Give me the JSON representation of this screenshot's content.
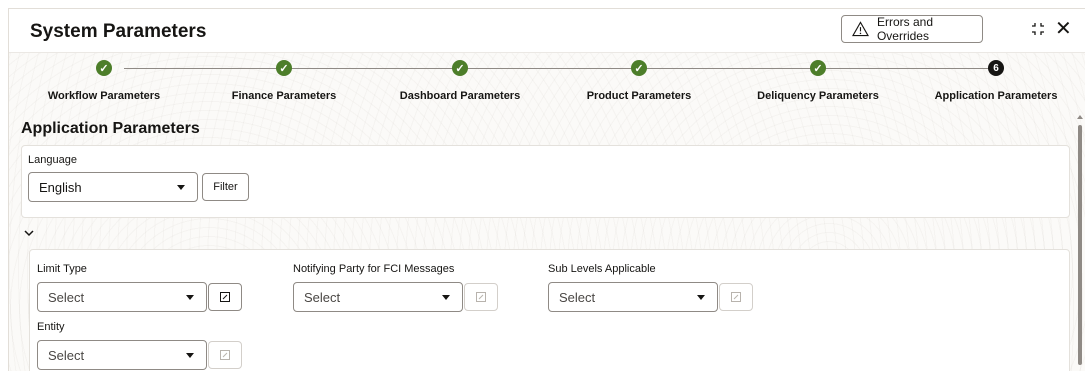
{
  "header": {
    "title": "System Parameters",
    "errors_button": "Errors and Overrides",
    "warning_icon": "warning-triangle-icon",
    "compress_icon": "compress-icon",
    "close_icon": "close-icon",
    "close_glyph": "✕"
  },
  "train": {
    "steps": [
      {
        "label": "Workflow Parameters",
        "status": "done",
        "marker": "✓"
      },
      {
        "label": "Finance Parameters",
        "status": "done",
        "marker": "✓"
      },
      {
        "label": "Dashboard Parameters",
        "status": "done",
        "marker": "✓"
      },
      {
        "label": "Product Parameters",
        "status": "done",
        "marker": "✓"
      },
      {
        "label": "Deliquency Parameters",
        "status": "done",
        "marker": "✓"
      },
      {
        "label": "Application Parameters",
        "status": "current",
        "marker": "6"
      }
    ]
  },
  "section": {
    "title": "Application Parameters"
  },
  "language": {
    "label": "Language",
    "value": "English",
    "filter_button": "Filter"
  },
  "details": {
    "limit_type": {
      "label": "Limit Type",
      "value": "Select"
    },
    "notifying_party": {
      "label": "Notifying Party for FCI Messages",
      "value": "Select"
    },
    "sub_levels": {
      "label": "Sub Levels Applicable",
      "value": "Select"
    },
    "entity": {
      "label": "Entity",
      "value": "Select"
    }
  },
  "colors": {
    "done_step": "#4d7e2a",
    "current_step": "#161513"
  }
}
